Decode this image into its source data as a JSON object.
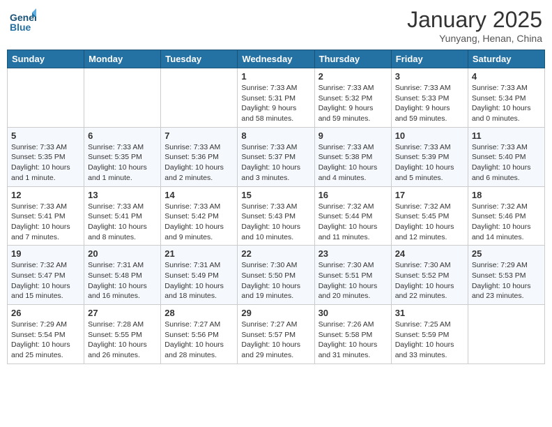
{
  "header": {
    "logo_text_1": "General",
    "logo_text_2": "Blue",
    "month": "January 2025",
    "location": "Yunyang, Henan, China"
  },
  "weekdays": [
    "Sunday",
    "Monday",
    "Tuesday",
    "Wednesday",
    "Thursday",
    "Friday",
    "Saturday"
  ],
  "rows": [
    [
      {
        "day": "",
        "lines": []
      },
      {
        "day": "",
        "lines": []
      },
      {
        "day": "",
        "lines": []
      },
      {
        "day": "1",
        "lines": [
          "Sunrise: 7:33 AM",
          "Sunset: 5:31 PM",
          "Daylight: 9 hours",
          "and 58 minutes."
        ]
      },
      {
        "day": "2",
        "lines": [
          "Sunrise: 7:33 AM",
          "Sunset: 5:32 PM",
          "Daylight: 9 hours",
          "and 59 minutes."
        ]
      },
      {
        "day": "3",
        "lines": [
          "Sunrise: 7:33 AM",
          "Sunset: 5:33 PM",
          "Daylight: 9 hours",
          "and 59 minutes."
        ]
      },
      {
        "day": "4",
        "lines": [
          "Sunrise: 7:33 AM",
          "Sunset: 5:34 PM",
          "Daylight: 10 hours",
          "and 0 minutes."
        ]
      }
    ],
    [
      {
        "day": "5",
        "lines": [
          "Sunrise: 7:33 AM",
          "Sunset: 5:35 PM",
          "Daylight: 10 hours",
          "and 1 minute."
        ]
      },
      {
        "day": "6",
        "lines": [
          "Sunrise: 7:33 AM",
          "Sunset: 5:35 PM",
          "Daylight: 10 hours",
          "and 1 minute."
        ]
      },
      {
        "day": "7",
        "lines": [
          "Sunrise: 7:33 AM",
          "Sunset: 5:36 PM",
          "Daylight: 10 hours",
          "and 2 minutes."
        ]
      },
      {
        "day": "8",
        "lines": [
          "Sunrise: 7:33 AM",
          "Sunset: 5:37 PM",
          "Daylight: 10 hours",
          "and 3 minutes."
        ]
      },
      {
        "day": "9",
        "lines": [
          "Sunrise: 7:33 AM",
          "Sunset: 5:38 PM",
          "Daylight: 10 hours",
          "and 4 minutes."
        ]
      },
      {
        "day": "10",
        "lines": [
          "Sunrise: 7:33 AM",
          "Sunset: 5:39 PM",
          "Daylight: 10 hours",
          "and 5 minutes."
        ]
      },
      {
        "day": "11",
        "lines": [
          "Sunrise: 7:33 AM",
          "Sunset: 5:40 PM",
          "Daylight: 10 hours",
          "and 6 minutes."
        ]
      }
    ],
    [
      {
        "day": "12",
        "lines": [
          "Sunrise: 7:33 AM",
          "Sunset: 5:41 PM",
          "Daylight: 10 hours",
          "and 7 minutes."
        ]
      },
      {
        "day": "13",
        "lines": [
          "Sunrise: 7:33 AM",
          "Sunset: 5:41 PM",
          "Daylight: 10 hours",
          "and 8 minutes."
        ]
      },
      {
        "day": "14",
        "lines": [
          "Sunrise: 7:33 AM",
          "Sunset: 5:42 PM",
          "Daylight: 10 hours",
          "and 9 minutes."
        ]
      },
      {
        "day": "15",
        "lines": [
          "Sunrise: 7:33 AM",
          "Sunset: 5:43 PM",
          "Daylight: 10 hours",
          "and 10 minutes."
        ]
      },
      {
        "day": "16",
        "lines": [
          "Sunrise: 7:32 AM",
          "Sunset: 5:44 PM",
          "Daylight: 10 hours",
          "and 11 minutes."
        ]
      },
      {
        "day": "17",
        "lines": [
          "Sunrise: 7:32 AM",
          "Sunset: 5:45 PM",
          "Daylight: 10 hours",
          "and 12 minutes."
        ]
      },
      {
        "day": "18",
        "lines": [
          "Sunrise: 7:32 AM",
          "Sunset: 5:46 PM",
          "Daylight: 10 hours",
          "and 14 minutes."
        ]
      }
    ],
    [
      {
        "day": "19",
        "lines": [
          "Sunrise: 7:32 AM",
          "Sunset: 5:47 PM",
          "Daylight: 10 hours",
          "and 15 minutes."
        ]
      },
      {
        "day": "20",
        "lines": [
          "Sunrise: 7:31 AM",
          "Sunset: 5:48 PM",
          "Daylight: 10 hours",
          "and 16 minutes."
        ]
      },
      {
        "day": "21",
        "lines": [
          "Sunrise: 7:31 AM",
          "Sunset: 5:49 PM",
          "Daylight: 10 hours",
          "and 18 minutes."
        ]
      },
      {
        "day": "22",
        "lines": [
          "Sunrise: 7:30 AM",
          "Sunset: 5:50 PM",
          "Daylight: 10 hours",
          "and 19 minutes."
        ]
      },
      {
        "day": "23",
        "lines": [
          "Sunrise: 7:30 AM",
          "Sunset: 5:51 PM",
          "Daylight: 10 hours",
          "and 20 minutes."
        ]
      },
      {
        "day": "24",
        "lines": [
          "Sunrise: 7:30 AM",
          "Sunset: 5:52 PM",
          "Daylight: 10 hours",
          "and 22 minutes."
        ]
      },
      {
        "day": "25",
        "lines": [
          "Sunrise: 7:29 AM",
          "Sunset: 5:53 PM",
          "Daylight: 10 hours",
          "and 23 minutes."
        ]
      }
    ],
    [
      {
        "day": "26",
        "lines": [
          "Sunrise: 7:29 AM",
          "Sunset: 5:54 PM",
          "Daylight: 10 hours",
          "and 25 minutes."
        ]
      },
      {
        "day": "27",
        "lines": [
          "Sunrise: 7:28 AM",
          "Sunset: 5:55 PM",
          "Daylight: 10 hours",
          "and 26 minutes."
        ]
      },
      {
        "day": "28",
        "lines": [
          "Sunrise: 7:27 AM",
          "Sunset: 5:56 PM",
          "Daylight: 10 hours",
          "and 28 minutes."
        ]
      },
      {
        "day": "29",
        "lines": [
          "Sunrise: 7:27 AM",
          "Sunset: 5:57 PM",
          "Daylight: 10 hours",
          "and 29 minutes."
        ]
      },
      {
        "day": "30",
        "lines": [
          "Sunrise: 7:26 AM",
          "Sunset: 5:58 PM",
          "Daylight: 10 hours",
          "and 31 minutes."
        ]
      },
      {
        "day": "31",
        "lines": [
          "Sunrise: 7:25 AM",
          "Sunset: 5:59 PM",
          "Daylight: 10 hours",
          "and 33 minutes."
        ]
      },
      {
        "day": "",
        "lines": []
      }
    ]
  ]
}
